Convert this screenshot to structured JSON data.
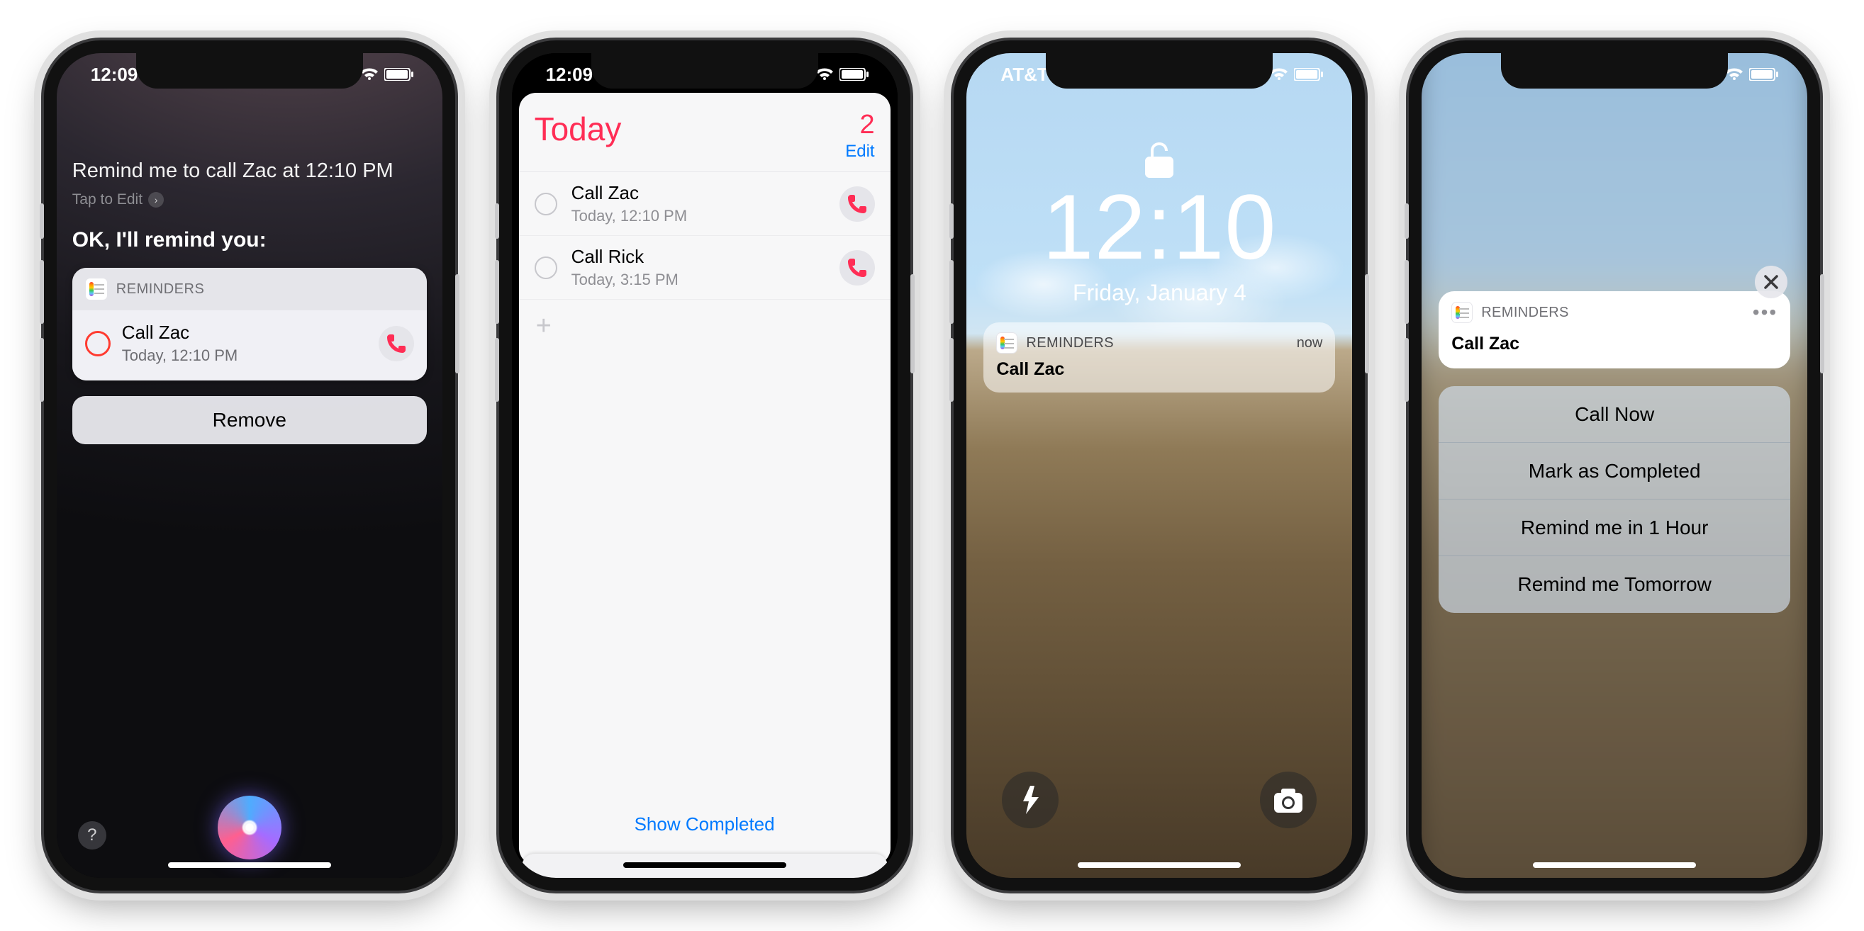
{
  "phone1": {
    "status_time": "12:09",
    "siri_query": "Remind me to call Zac at 12:10 PM",
    "tap_to_edit": "Tap to Edit",
    "siri_reply": "OK, I'll remind you:",
    "card_app": "REMINDERS",
    "card_title": "Call Zac",
    "card_sub": "Today, 12:10 PM",
    "remove": "Remove",
    "help": "?"
  },
  "phone2": {
    "status_time": "12:09",
    "title": "Today",
    "count": "2",
    "edit": "Edit",
    "items": [
      {
        "title": "Call Zac",
        "sub": "Today, 12:10 PM"
      },
      {
        "title": "Call Rick",
        "sub": "Today, 3:15 PM"
      }
    ],
    "add": "+",
    "show_completed": "Show Completed"
  },
  "phone3": {
    "carrier": "AT&T",
    "time": "12:10",
    "date": "Friday, January 4",
    "notif_app": "REMINDERS",
    "notif_time": "now",
    "notif_title": "Call Zac"
  },
  "phone4": {
    "notif_app": "REMINDERS",
    "notif_title": "Call Zac",
    "actions": [
      "Call Now",
      "Mark as Completed",
      "Remind me in 1 Hour",
      "Remind me Tomorrow"
    ]
  }
}
